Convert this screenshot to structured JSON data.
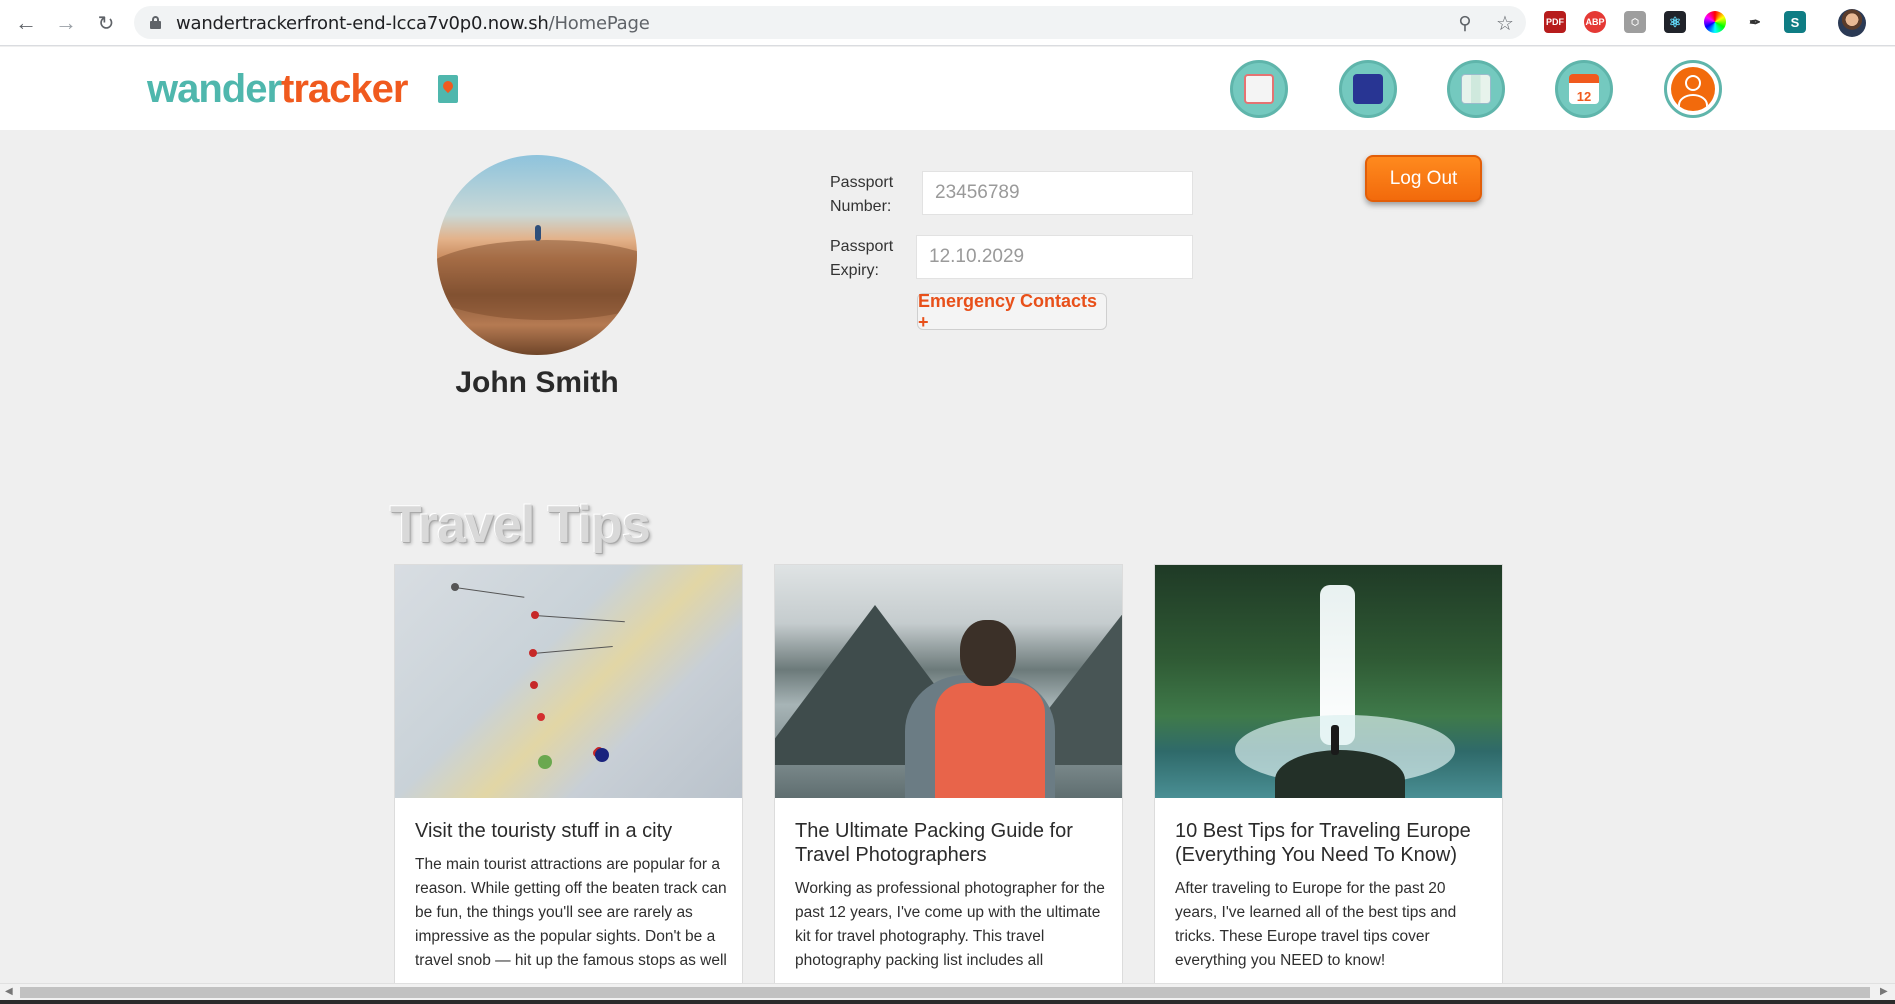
{
  "browser": {
    "url_host": "wandertrackerfront-end-lcca7v0p0.now.sh",
    "url_path": "/HomePage"
  },
  "header": {
    "logo_part1": "wander",
    "logo_part2": "tracker",
    "nav_icons": [
      "passport-stamp-icon",
      "passport-globe-icon",
      "map-pin-icon",
      "calendar-icon",
      "user-profile-icon"
    ]
  },
  "profile": {
    "name": "John Smith",
    "passport_number_label": "Passport\nNumber:",
    "passport_number_placeholder": "23456789",
    "passport_expiry_label": "Passport\nExpiry:",
    "passport_expiry_placeholder": "12.10.2029",
    "emergency_button": "Emergency Contacts +",
    "logout_button": "Log Out"
  },
  "travel_tips": {
    "title": "Travel Tips",
    "cards": [
      {
        "title": "Visit the touristy stuff in a city",
        "text": "The main tourist attractions are popular for a reason. While getting off the beaten track can be fun, the things you'll see are rarely as impressive as the popular sights. Don't be a travel snob — hit up the famous stops as well"
      },
      {
        "title": "The Ultimate Packing Guide for Travel Photographers",
        "text": "Working as professional photographer for the past 12 years, I've come up with the ultimate kit for travel photography. This travel photography packing list includes all"
      },
      {
        "title": "10 Best Tips for Traveling Europe (Everything You Need To Know)",
        "text": "After traveling to Europe for the past 20 years, I've learned all of the best tips and tricks. These Europe travel tips cover everything you NEED to know!"
      }
    ]
  },
  "colors": {
    "brand_teal": "#4fb7ad",
    "brand_orange": "#f05a1e",
    "logout_orange": "#f26a0c"
  }
}
